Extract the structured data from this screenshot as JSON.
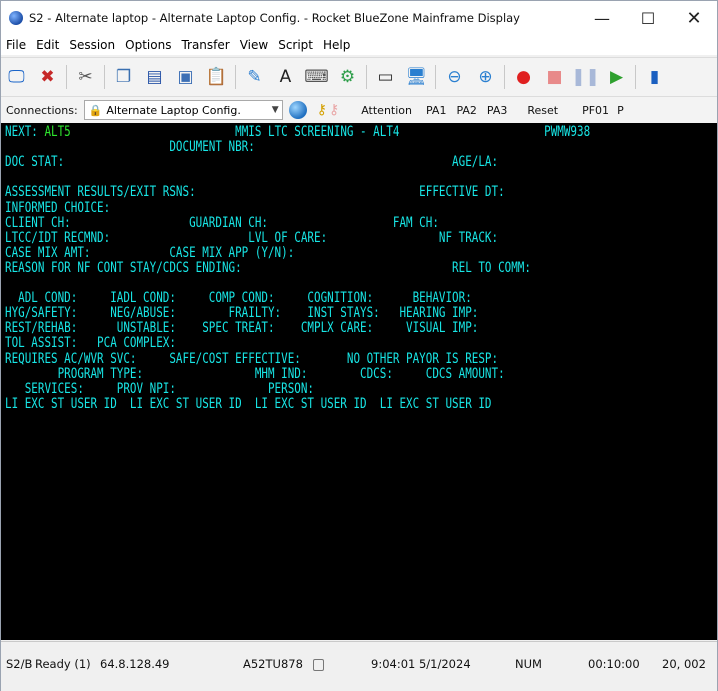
{
  "window": {
    "title": "S2 - Alternate laptop - Alternate Laptop Config. - Rocket BlueZone Mainframe Display",
    "minimize": "—",
    "maximize": "☐",
    "close": "✕"
  },
  "menu": [
    {
      "label": "File"
    },
    {
      "label": "Edit"
    },
    {
      "label": "Session"
    },
    {
      "label": "Options"
    },
    {
      "label": "Transfer"
    },
    {
      "label": "View"
    },
    {
      "label": "Script"
    },
    {
      "label": "Help"
    }
  ],
  "toolbar": {
    "icons": [
      {
        "name": "new-session-icon",
        "glyph": "🖵",
        "color": "#1a64c8"
      },
      {
        "name": "disconnect-icon",
        "glyph": "✖",
        "color": "#c62828"
      },
      {
        "name": "cut-icon",
        "glyph": "✂",
        "color": "#555555"
      },
      {
        "name": "copy-icon",
        "glyph": "❐",
        "color": "#3a6fb0"
      },
      {
        "name": "save-icon",
        "glyph": "▤",
        "color": "#2a56a8"
      },
      {
        "name": "print-icon",
        "glyph": "▣",
        "color": "#3c6fb5"
      },
      {
        "name": "paste-icon",
        "glyph": "📋",
        "color": "#b08a2e"
      },
      {
        "name": "edit-icon",
        "glyph": "✎",
        "color": "#2e7fd0"
      },
      {
        "name": "font-icon",
        "glyph": "A",
        "color": "#222222"
      },
      {
        "name": "keyboard-icon",
        "glyph": "⌨",
        "color": "#555555"
      },
      {
        "name": "macro-icon",
        "glyph": "⚙",
        "color": "#2e9e4a"
      },
      {
        "name": "window-icon",
        "glyph": "▭",
        "color": "#333333"
      },
      {
        "name": "display-icon",
        "glyph": "🖥",
        "color": "#2a7fd0"
      },
      {
        "name": "zoom-out-icon",
        "glyph": "⊖",
        "color": "#2a7fd0"
      },
      {
        "name": "zoom-in-icon",
        "glyph": "⊕",
        "color": "#2a7fd0"
      },
      {
        "name": "record-icon",
        "glyph": "●",
        "color": "#e02020"
      },
      {
        "name": "stop-icon",
        "glyph": "■",
        "color": "#e88a8a"
      },
      {
        "name": "pause-icon",
        "glyph": "❚❚",
        "color": "#a8b8d8"
      },
      {
        "name": "play-icon",
        "glyph": "▶",
        "color": "#2ea02e"
      },
      {
        "name": "document-icon",
        "glyph": "▮",
        "color": "#1a5fc0"
      }
    ]
  },
  "connections": {
    "label": "Connections:",
    "selected": "Alternate Laptop Config.",
    "buttons": [
      "Attention",
      "PA1",
      "PA2",
      "PA3",
      "Reset",
      "PF01",
      "P"
    ]
  },
  "screen": {
    "next_label": "NEXT:",
    "next_value": "ALT5",
    "title": "MMIS LTC SCREENING - ALT4",
    "screen_id": "PWMW938",
    "rows": [
      "                         DOCUMENT NBR:",
      "DOC STAT:                                                           AGE/LA:",
      "",
      "ASSESSMENT RESULTS/EXIT RSNS:                                  EFFECTIVE DT:",
      "INFORMED CHOICE:",
      "CLIENT CH:                  GUARDIAN CH:                   FAM CH:",
      "LTCC/IDT RECMND:                     LVL OF CARE:                 NF TRACK:",
      "CASE MIX AMT:            CASE MIX APP (Y/N):",
      "REASON FOR NF CONT STAY/CDCS ENDING:                                REL TO COMM:",
      "",
      "  ADL COND:     IADL COND:     COMP COND:     COGNITION:      BEHAVIOR:",
      "HYG/SAFETY:     NEG/ABUSE:        FRAILTY:    INST STAYS:   HEARING IMP:",
      "REST/REHAB:      UNSTABLE:    SPEC TREAT:    CMPLX CARE:     VISUAL IMP:",
      "TOL ASSIST:   PCA COMPLEX:",
      "REQUIRES AC/WVR SVC:     SAFE/COST EFFECTIVE:       NO OTHER PAYOR IS RESP:",
      "        PROGRAM TYPE:                 MHM IND:        CDCS:     CDCS AMOUNT:",
      "   SERVICES:     PROV NPI:              PERSON:",
      "LI EXC ST USER ID  LI EXC ST USER ID  LI EXC ST USER ID  LI EXC ST USER ID"
    ]
  },
  "status": {
    "session": "S2/B",
    "state": "Ready (1)",
    "host": "64.8.128.49",
    "lu": "A52TU878",
    "time": "9:04:01 5/1/2024",
    "num": "NUM",
    "elapsed": "00:10:00",
    "cursor": "20, 002"
  }
}
